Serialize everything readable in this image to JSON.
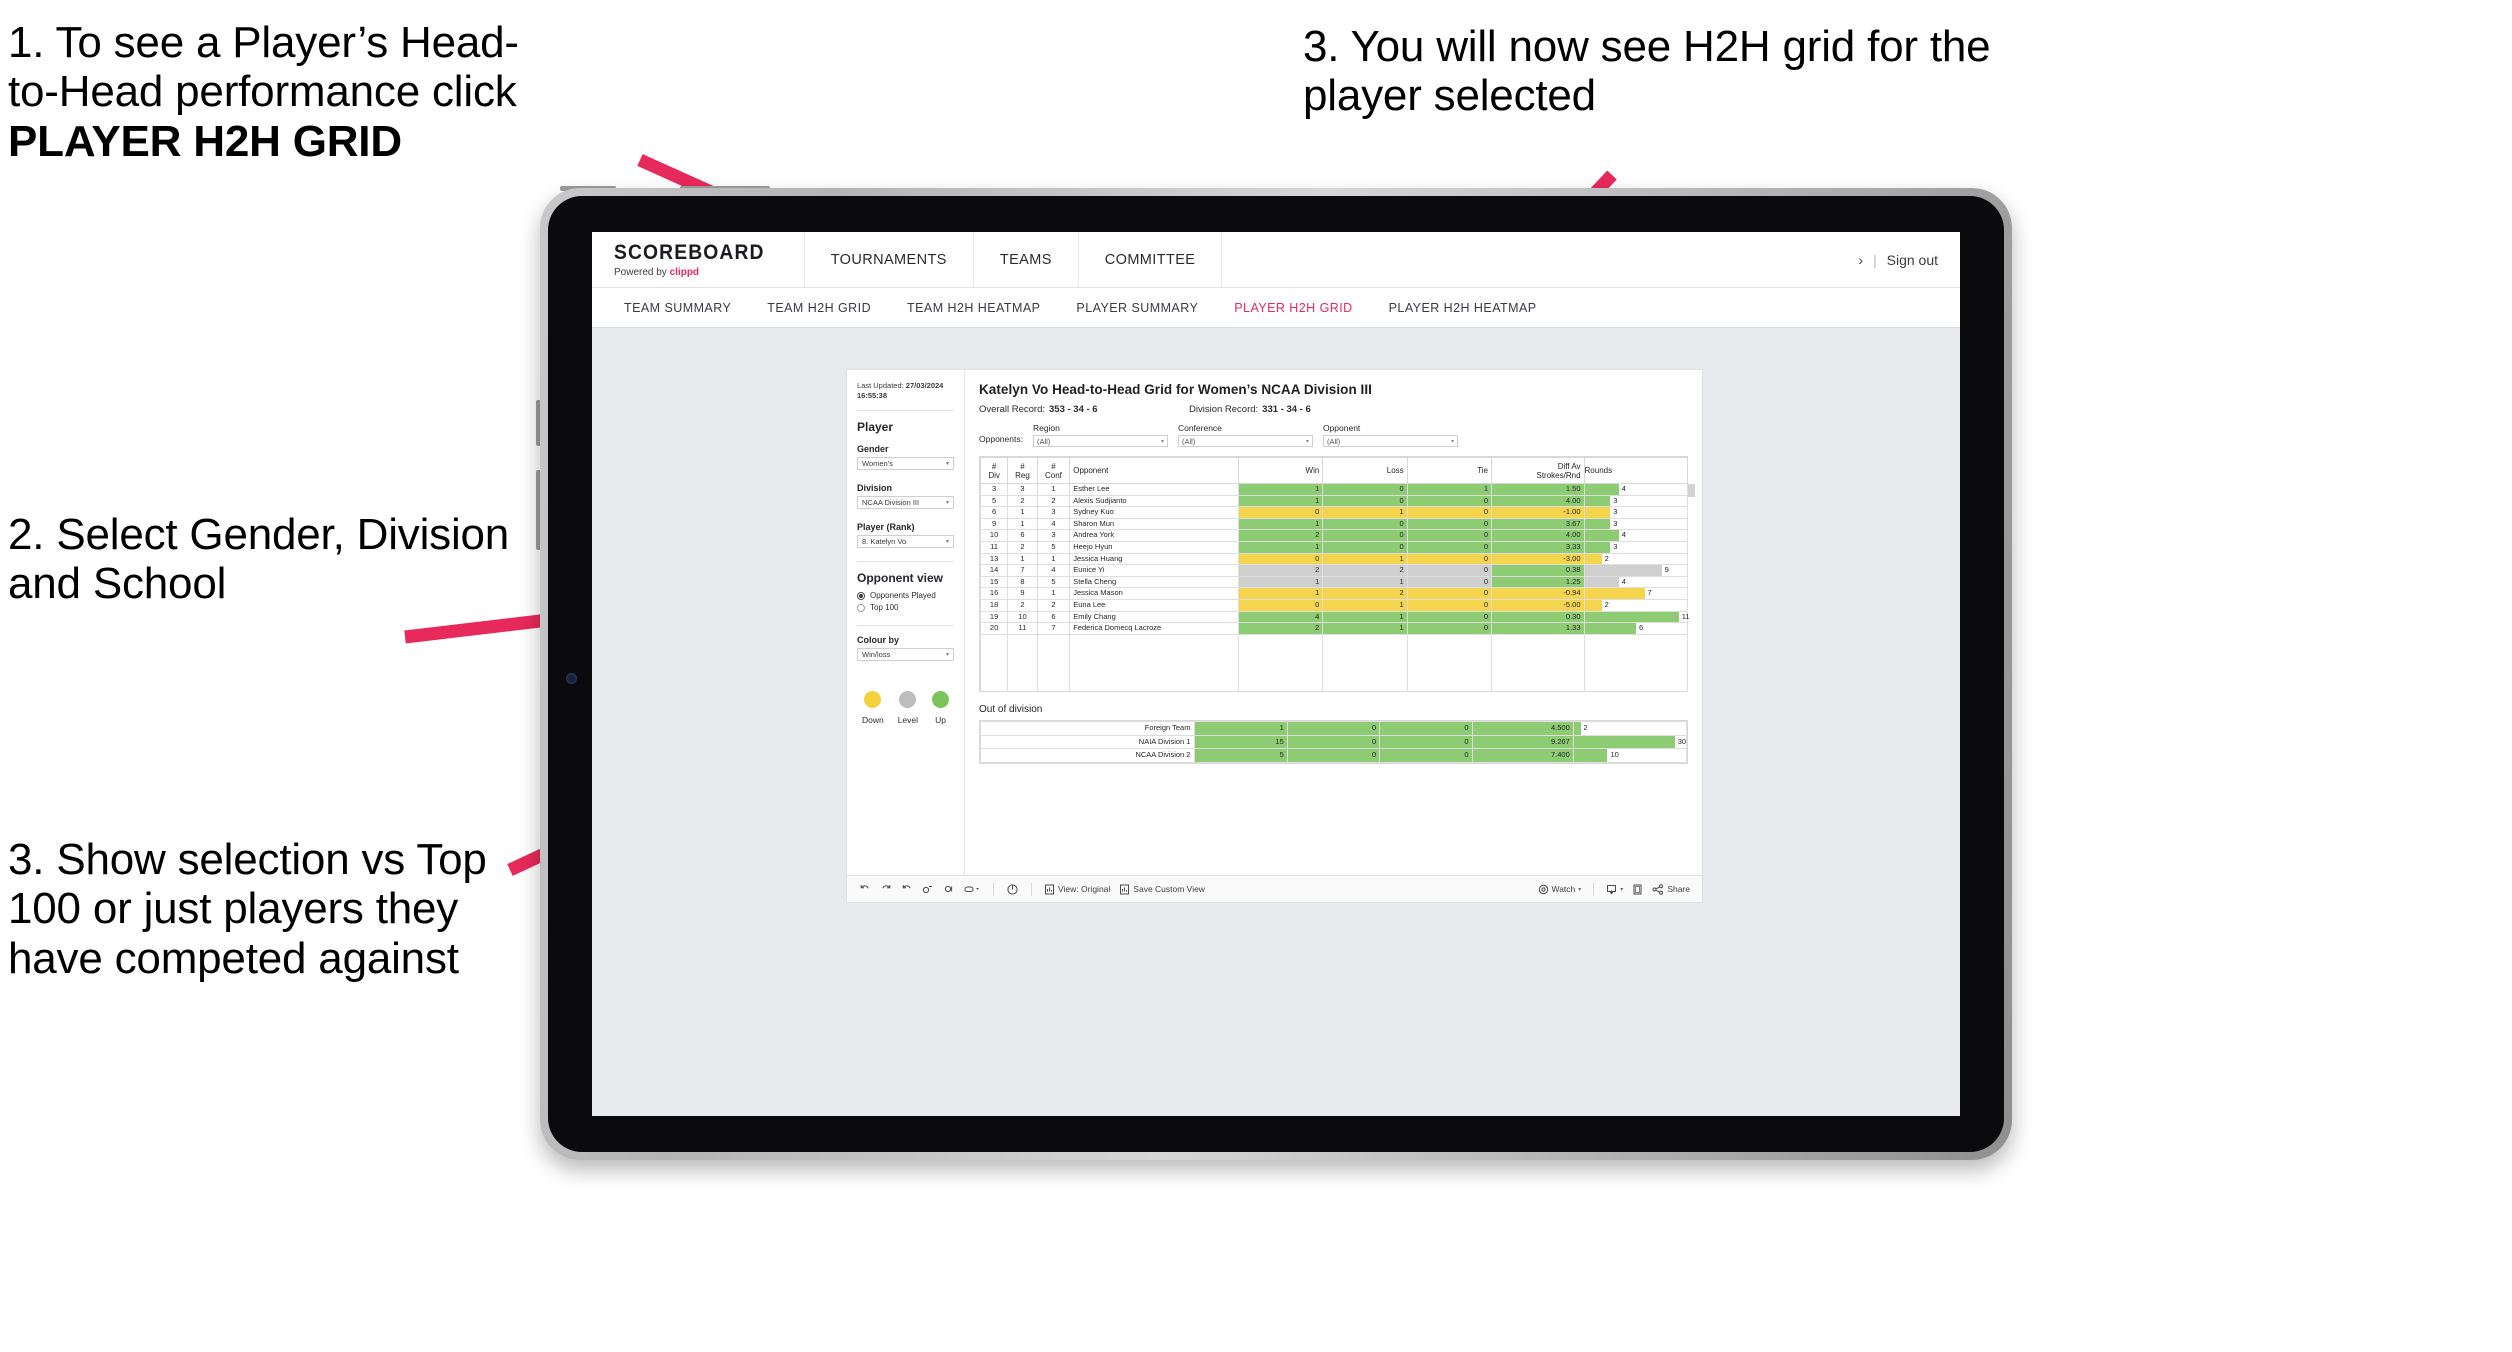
{
  "annotations": {
    "step1_line1": "1. To see a Player’s Head-",
    "step1_line2": "to-Head performance click",
    "step1_bold": "PLAYER H2H GRID",
    "step2": "2. Select Gender, Division and School",
    "step3_left": "3. Show selection vs Top 100 or just players they have competed against",
    "step3_right": "3. You will now see H2H grid for the player selected",
    "arrow_color": "#e8295b"
  },
  "topnav": {
    "brand_name": "SCOREBOARD",
    "brand_tagline_pre": "Powered by ",
    "brand_tagline_accent": "clippd",
    "items": [
      "TOURNAMENTS",
      "TEAMS",
      "COMMITTEE"
    ],
    "user_chevron": "›",
    "separator": "|",
    "signout": "Sign out"
  },
  "subnav": {
    "items": [
      {
        "label": "TEAM SUMMARY",
        "active": false
      },
      {
        "label": "TEAM H2H GRID",
        "active": false
      },
      {
        "label": "TEAM H2H HEATMAP",
        "active": false
      },
      {
        "label": "PLAYER SUMMARY",
        "active": false
      },
      {
        "label": "PLAYER H2H GRID",
        "active": true
      },
      {
        "label": "PLAYER H2H HEATMAP",
        "active": false
      }
    ],
    "active_color": "#e8295b"
  },
  "filters": {
    "last_updated_label": "Last Updated: ",
    "last_updated_date": "27/03/2024",
    "last_updated_time": "16:55:38",
    "section_player": "Player",
    "gender_label": "Gender",
    "gender_value": "Women's",
    "division_label": "Division",
    "division_value": "NCAA Division III",
    "player_label": "Player (Rank)",
    "player_value": "8. Katelyn Vo",
    "section_opponent_view": "Opponent view",
    "radio_opponents_played": "Opponents Played",
    "radio_top100": "Top 100",
    "colour_by_label": "Colour by",
    "colour_by_value": "Win/loss",
    "legend": [
      {
        "label": "Down",
        "color": "#f2d23f"
      },
      {
        "label": "Level",
        "color": "#bdbdbd"
      },
      {
        "label": "Up",
        "color": "#7cc35b"
      }
    ],
    "caret": "▾"
  },
  "content": {
    "title": "Katelyn Vo Head-to-Head Grid for Women’s NCAA Division III",
    "overall_record_label": "Overall Record:",
    "overall_record_value": "353 -  34 - 6",
    "division_record_label": "Division Record:",
    "division_record_value": "331 -  34 - 6",
    "opponents_label": "Opponents:",
    "opponent_filters": [
      {
        "label": "Region",
        "value": "(All)"
      },
      {
        "label": "Conference",
        "value": "(All)"
      },
      {
        "label": "Opponent",
        "value": "(All)"
      }
    ],
    "caret": "▾"
  },
  "chart_data": {
    "type": "table",
    "title": "Katelyn Vo Head-to-Head Grid for Women’s NCAA Division III",
    "columns": [
      "# Div",
      "# Reg",
      "# Conf",
      "Opponent",
      "Win",
      "Loss",
      "Tie",
      "Diff Av Strokes/Rnd",
      "Rounds"
    ],
    "column_header_lines": [
      [
        "#",
        "Div"
      ],
      [
        "#",
        "Reg"
      ],
      [
        "#",
        "Conf"
      ],
      [
        "Opponent"
      ],
      [
        "Win"
      ],
      [
        "Loss"
      ],
      [
        "Tie"
      ],
      [
        "Diff Av",
        "Strokes/Rnd"
      ],
      [
        "Rounds"
      ]
    ],
    "rows": [
      {
        "div": "3",
        "reg": "3",
        "conf": "1",
        "opponent": "Esther Lee",
        "win": "1",
        "loss": "0",
        "tie": "1",
        "diff": "1.50",
        "rounds": "4",
        "rounds_num": 4,
        "state": "win"
      },
      {
        "div": "5",
        "reg": "2",
        "conf": "2",
        "opponent": "Alexis Sudjianto",
        "win": "1",
        "loss": "0",
        "tie": "0",
        "diff": "4.00",
        "rounds": "3",
        "rounds_num": 3,
        "state": "win"
      },
      {
        "div": "6",
        "reg": "1",
        "conf": "3",
        "opponent": "Sydney Kuo",
        "win": "0",
        "loss": "1",
        "tie": "0",
        "diff": "-1.00",
        "rounds": "3",
        "rounds_num": 3,
        "state": "loss"
      },
      {
        "div": "9",
        "reg": "1",
        "conf": "4",
        "opponent": "Sharon Mun",
        "win": "1",
        "loss": "0",
        "tie": "0",
        "diff": "3.67",
        "rounds": "3",
        "rounds_num": 3,
        "state": "win"
      },
      {
        "div": "10",
        "reg": "6",
        "conf": "3",
        "opponent": "Andrea York",
        "win": "2",
        "loss": "0",
        "tie": "0",
        "diff": "4.00",
        "rounds": "4",
        "rounds_num": 4,
        "state": "win"
      },
      {
        "div": "11",
        "reg": "2",
        "conf": "5",
        "opponent": "Heejo Hyun",
        "win": "1",
        "loss": "0",
        "tie": "0",
        "diff": "3.33",
        "rounds": "3",
        "rounds_num": 3,
        "state": "win"
      },
      {
        "div": "13",
        "reg": "1",
        "conf": "1",
        "opponent": "Jessica Huang",
        "win": "0",
        "loss": "1",
        "tie": "0",
        "diff": "-3.00",
        "rounds": "2",
        "rounds_num": 2,
        "state": "loss"
      },
      {
        "div": "14",
        "reg": "7",
        "conf": "4",
        "opponent": "Eunice Yi",
        "win": "2",
        "loss": "2",
        "tie": "0",
        "diff": "0.38",
        "rounds": "9",
        "rounds_num": 9,
        "state": "tie",
        "diff_state": "win"
      },
      {
        "div": "15",
        "reg": "8",
        "conf": "5",
        "opponent": "Stella Cheng",
        "win": "1",
        "loss": "1",
        "tie": "0",
        "diff": "1.25",
        "rounds": "4",
        "rounds_num": 4,
        "state": "tie",
        "diff_state": "win"
      },
      {
        "div": "16",
        "reg": "9",
        "conf": "1",
        "opponent": "Jessica Mason",
        "win": "1",
        "loss": "2",
        "tie": "0",
        "diff": "-0.94",
        "rounds": "7",
        "rounds_num": 7,
        "state": "loss"
      },
      {
        "div": "18",
        "reg": "2",
        "conf": "2",
        "opponent": "Euna Lee",
        "win": "0",
        "loss": "1",
        "tie": "0",
        "diff": "-5.00",
        "rounds": "2",
        "rounds_num": 2,
        "state": "loss"
      },
      {
        "div": "19",
        "reg": "10",
        "conf": "6",
        "opponent": "Emily Chang",
        "win": "4",
        "loss": "1",
        "tie": "0",
        "diff": "0.30",
        "rounds": "11",
        "rounds_num": 11,
        "state": "win"
      },
      {
        "div": "20",
        "reg": "11",
        "conf": "7",
        "opponent": "Federica Domecq Lacroze",
        "win": "2",
        "loss": "1",
        "tie": "0",
        "diff": "1.33",
        "rounds": "6",
        "rounds_num": 6,
        "state": "win"
      }
    ],
    "rounds_max": 11,
    "out_of_division": {
      "title": "Out of division",
      "rows": [
        {
          "name": "Foreign Team",
          "win": "1",
          "loss": "0",
          "tie": "0",
          "diff": "4.500",
          "rounds": "2",
          "rounds_num": 2,
          "state": "win"
        },
        {
          "name": "NAIA Division 1",
          "win": "15",
          "loss": "0",
          "tie": "0",
          "diff": "9.267",
          "rounds": "30",
          "rounds_num": 30,
          "state": "win"
        },
        {
          "name": "NCAA Division 2",
          "win": "5",
          "loss": "0",
          "tie": "0",
          "diff": "7.400",
          "rounds": "10",
          "rounds_num": 10,
          "state": "win"
        }
      ],
      "rounds_max": 30
    },
    "colors": {
      "win": "#8dcc72",
      "loss": "#f5d44e",
      "tie": "#cfcfcf"
    }
  },
  "toolbar": {
    "view_label": "View: Original",
    "save_label": "Save Custom View",
    "watch_label": "Watch",
    "share_label": "Share",
    "caret": "▾"
  }
}
